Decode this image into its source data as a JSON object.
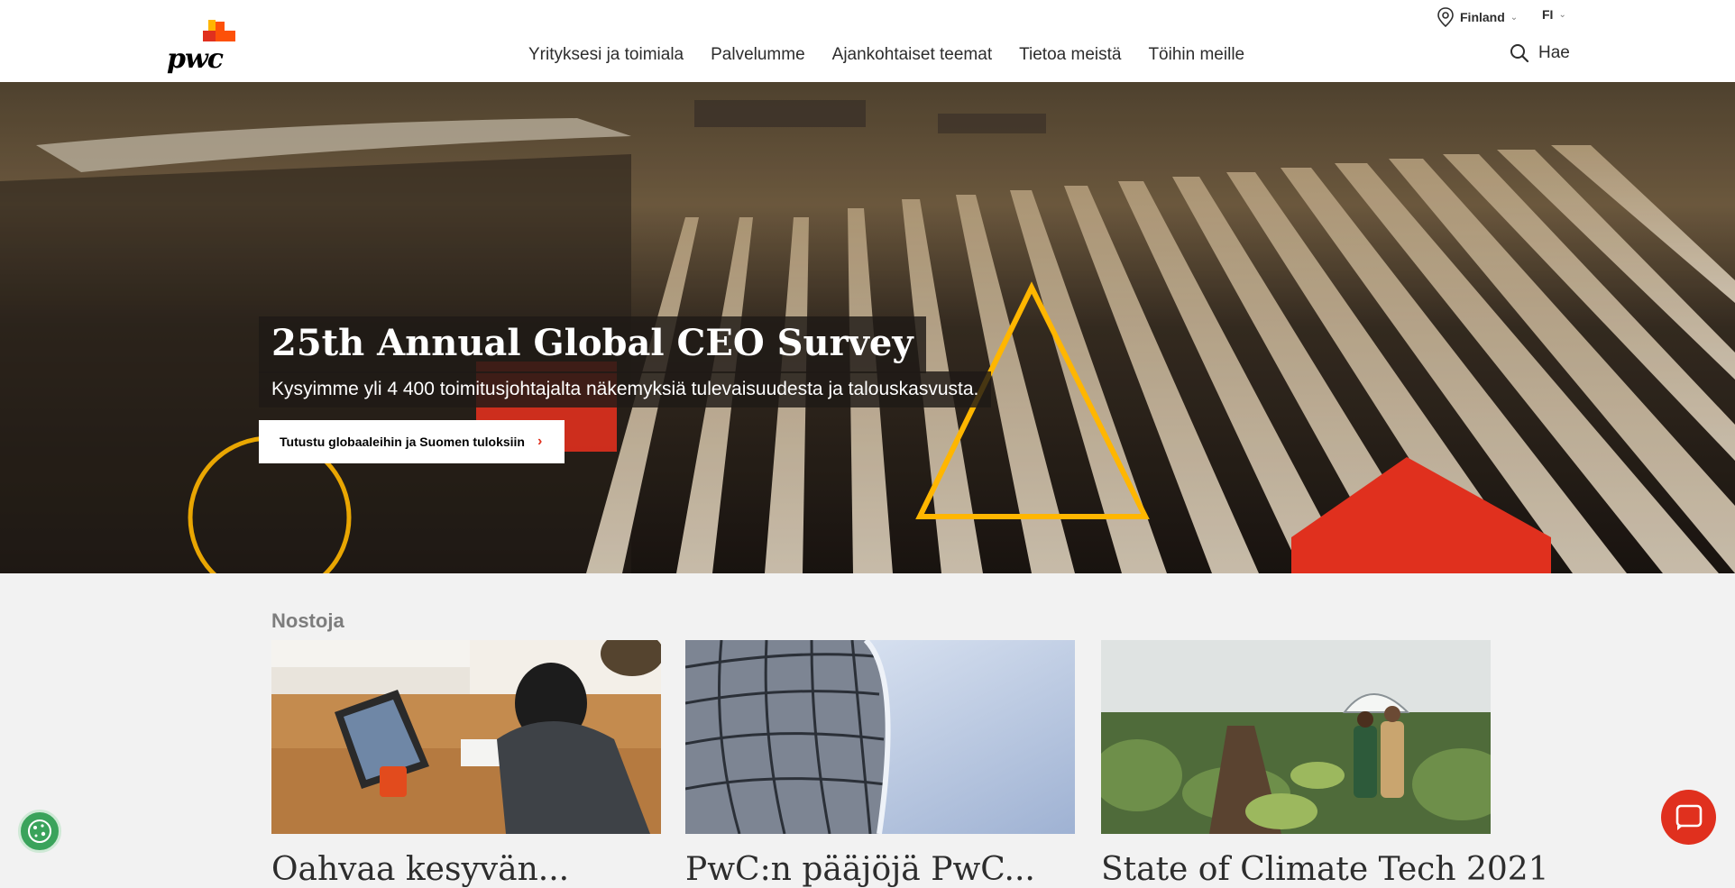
{
  "header": {
    "logo_text": "pwc",
    "country": "Finland",
    "language": "FI",
    "nav": [
      {
        "label": "Yrityksesi ja toimiala"
      },
      {
        "label": "Palvelumme"
      },
      {
        "label": "Ajankohtaiset teemat"
      },
      {
        "label": "Tietoa meistä"
      },
      {
        "label": "Töihin meille"
      }
    ],
    "search_label": "Hae"
  },
  "hero": {
    "title": "25th Annual Global CEO Survey",
    "subtitle": "Kysyimme yli 4 400 toimitusjohtajalta näkemyksiä tulevaisuudesta ja talouskasvusta.",
    "cta_label": "Tutustu globaaleihin ja Suomen tuloksiin"
  },
  "highlights": {
    "title": "Nostoja",
    "cards": [
      {
        "title": "Oahvaa kesyvän..."
      },
      {
        "title": "PwC:n pääjöjä PwC..."
      },
      {
        "title": "State of Climate Tech 2021"
      }
    ]
  },
  "colors": {
    "brand_orange": "#fd5108",
    "brand_red": "#e0301e",
    "accent_yellow": "#ffb600",
    "cookie_green": "#3aa35b"
  },
  "icons": {
    "location": "location-pin-icon",
    "search": "search-icon",
    "chevron": "chevron-down-icon",
    "cta_arrow": "chevron-right-icon",
    "cookie": "cookie-icon",
    "chat": "chat-icon"
  }
}
